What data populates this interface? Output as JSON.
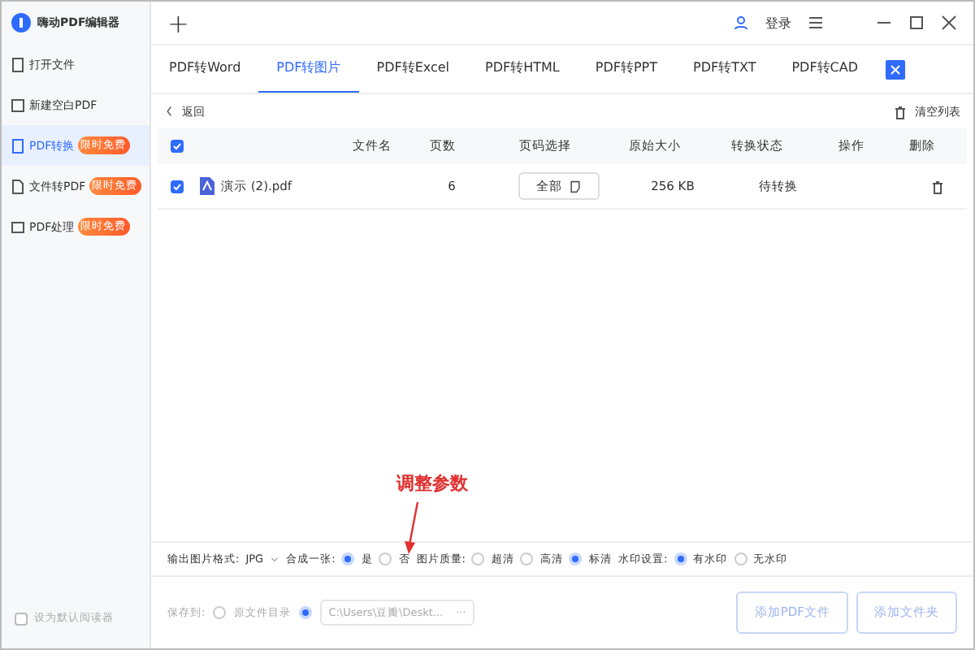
{
  "app": {
    "title": "嗨动PDF编辑器"
  },
  "titlebar": {
    "new_tab": "+",
    "login": "登录"
  },
  "sidebar": {
    "items": [
      {
        "label": "打开文件",
        "selected": false
      },
      {
        "label": "新建空白PDF",
        "selected": false
      },
      {
        "label": "PDF转换",
        "selected": true,
        "badge": "限时免费"
      },
      {
        "label": "文件转PDF",
        "selected": false,
        "badge": "限时免费"
      },
      {
        "label": "PDF处理",
        "selected": false,
        "badge": "限时免费"
      }
    ],
    "default_reader": {
      "label": "设为默认阅读器",
      "checked": false
    }
  },
  "tabs": [
    {
      "label": "PDF转Word",
      "selected": false
    },
    {
      "label": "PDF转图片",
      "selected": true
    },
    {
      "label": "PDF转Excel",
      "selected": false
    },
    {
      "label": "PDF转HTML",
      "selected": false
    },
    {
      "label": "PDF转PPT",
      "selected": false
    },
    {
      "label": "PDF转TXT",
      "selected": false
    },
    {
      "label": "PDF转CAD",
      "selected": false
    }
  ],
  "toolbar": {
    "back": "返回",
    "clear": "清空列表"
  },
  "table": {
    "all_checked": true,
    "columns": [
      "文件名",
      "页数",
      "页码选择",
      "原始大小",
      "转换状态",
      "操作",
      "删除"
    ],
    "rows": [
      {
        "checked": true,
        "name": "演示 (2).pdf",
        "pages": "6",
        "page_select": "全部",
        "size": "256 KB",
        "status": "待转换"
      }
    ]
  },
  "options": {
    "format_label": "输出图片格式:",
    "format": "JPG",
    "merge_label": "合成一张:",
    "merge": [
      {
        "label": "是",
        "selected": true
      },
      {
        "label": "否",
        "selected": false
      }
    ],
    "quality_label": "图片质量:",
    "quality": [
      {
        "label": "超清",
        "selected": false
      },
      {
        "label": "高清",
        "selected": false
      },
      {
        "label": "标清",
        "selected": true
      }
    ],
    "watermark_label": "水印设置:",
    "watermark": [
      {
        "label": "有水印",
        "selected": true
      },
      {
        "label": "无水印",
        "selected": false
      }
    ]
  },
  "save": {
    "label": "保存到:",
    "options": [
      {
        "label": "原文件目录",
        "selected": false
      },
      {
        "selected": true
      }
    ],
    "path": "C:\\Users\\豆瓣\\Deskt...",
    "more": "···",
    "add_pdf": "添加PDF文件",
    "add_folder": "添加文件夹"
  },
  "annotation": {
    "text": "调整参数"
  }
}
